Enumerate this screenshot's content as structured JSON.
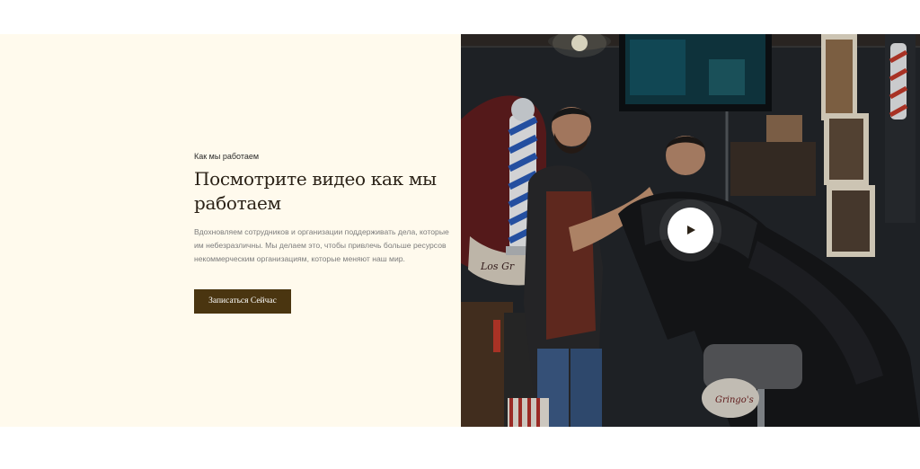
{
  "section": {
    "eyebrow": "Как мы работаем",
    "heading": "Посмотрите видео как мы работаем",
    "description": "Вдохновляем сотрудников и организации поддерживать дела, которые им небезразличны. Мы делаем это, чтобы привлечь больше ресурсов некоммерческим организациям, которые меняют наш мир.",
    "cta_label": "Записаться Сейчас"
  },
  "video": {
    "play_icon": "play-icon",
    "mural_text": "Los Gr",
    "chair_text": "Gringo's"
  },
  "colors": {
    "left_bg": "#fffaed",
    "button_bg": "#4a3510",
    "heading": "#2b2217"
  }
}
